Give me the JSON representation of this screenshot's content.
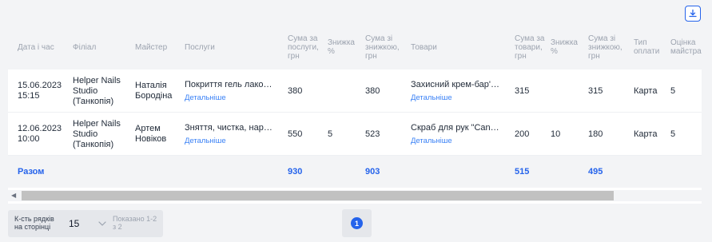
{
  "icons": {
    "download": "download-icon",
    "chevron": "chevron-down-icon",
    "scroll_left": "scroll-left-icon"
  },
  "colors": {
    "accent": "#2563eb",
    "header_bg": "#f3f4f6",
    "link": "#3b82f6",
    "muted": "#9ca3af"
  },
  "table": {
    "columns": [
      "Дата і час",
      "Філіал",
      "Майстер",
      "Послуги",
      "Сума за послуги, грн",
      "Знижка %",
      "Сума зі знижкою, грн",
      "Товари",
      "Сума за товари, грн",
      "Знижка %",
      "Сума зі знижкою, грн",
      "Тип оплати",
      "Оцінка майстра"
    ],
    "rows": [
      {
        "date": "15.06.2023",
        "time": "15:15",
        "branch": "Helper Nails Studio (Танкопія)",
        "master": "Наталія Бородіна",
        "services": "Покриття гель лаком сталь",
        "services_link": "Детальніше",
        "services_sum": "380",
        "services_discount": "",
        "services_total": "380",
        "goods": "Захисний крем-бар'єр для рук",
        "goods_link": "Детальніше",
        "goods_sum": "315",
        "goods_discount": "",
        "goods_total": "315",
        "payment": "Карта",
        "rating": "5"
      },
      {
        "date": "12.06.2023",
        "time": "10:00",
        "branch": "Helper Nails Studio (Танкопія)",
        "master": "Артем Новіков",
        "services": "Зняття, чистка, нарощування",
        "services_link": "Детальніше",
        "services_sum": "550",
        "services_discount": "5",
        "services_total": "523",
        "goods": "Скраб для рук \"Candy shop\"",
        "goods_link": "Детальніше",
        "goods_sum": "200",
        "goods_discount": "10",
        "goods_total": "180",
        "payment": "Карта",
        "rating": "5"
      }
    ],
    "totals": {
      "label": "Разом",
      "services_sum": "930",
      "services_total": "903",
      "goods_sum": "515",
      "goods_total": "495"
    }
  },
  "footer": {
    "rows_label": "К-сть рядків на сторінці",
    "rows_value": "15",
    "shown_text": "Показано 1-2 з 2",
    "current_page": "1"
  }
}
